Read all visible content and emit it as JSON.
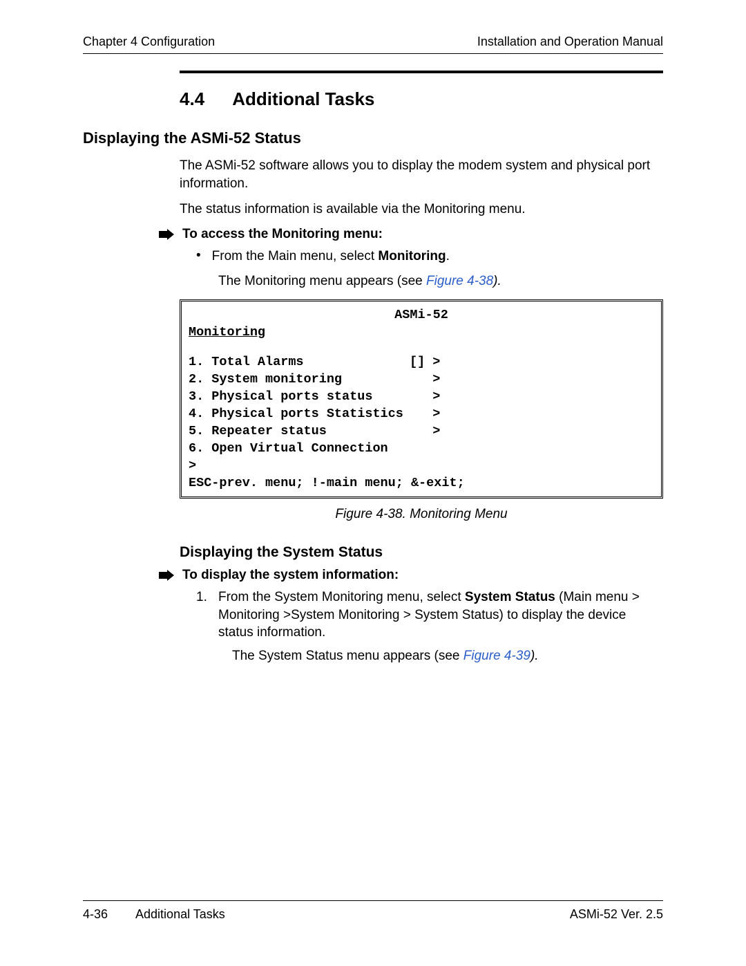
{
  "header": {
    "left": "Chapter 4  Configuration",
    "right": "Installation and Operation Manual"
  },
  "section": {
    "number": "4.4",
    "title": "Additional Tasks"
  },
  "sub1": {
    "title": "Displaying the ASMi-52 Status",
    "para1": "The ASMi-52 software allows you to display the modem system and physical port information.",
    "para2": "The status information is available via the Monitoring menu."
  },
  "proc1": {
    "title": "To access the Monitoring menu:",
    "bullet_pre": "From the Main menu, select ",
    "bullet_bold": "Monitoring",
    "bullet_post": ".",
    "sub_pre": "The Monitoring menu appears (see ",
    "sub_link": "Figure 4-38",
    "sub_post": ")."
  },
  "terminal": {
    "title": "ASMi-52",
    "subtitle": "Monitoring",
    "items": [
      {
        "label": "1. Total Alarms",
        "ind": "[] >"
      },
      {
        "label": "2. System monitoring",
        "ind": "   >"
      },
      {
        "label": "3. Physical ports status",
        "ind": "   >"
      },
      {
        "label": "4. Physical ports Statistics",
        "ind": "   >"
      },
      {
        "label": "5. Repeater status",
        "ind": "   >"
      },
      {
        "label": "6. Open Virtual Connection",
        "ind": ""
      }
    ],
    "prompt": ">",
    "footer": "ESC-prev. menu; !-main menu; &-exit;"
  },
  "figure_caption": "Figure 4-38.  Monitoring Menu",
  "subsub": {
    "title": "Displaying the System Status"
  },
  "proc2": {
    "title": "To display the system information:",
    "step1_num": "1.",
    "step1_pre": "From the System Monitoring menu, select ",
    "step1_bold": "System Status",
    "step1_post": " (Main menu > Monitoring >System Monitoring > System Status) to display the device status information.",
    "sub_pre": "The System Status menu appears (see ",
    "sub_link": "Figure 4-39",
    "sub_post": ")."
  },
  "footer": {
    "page": "4-36",
    "section": "Additional Tasks",
    "version": "ASMi-52 Ver. 2.5"
  }
}
